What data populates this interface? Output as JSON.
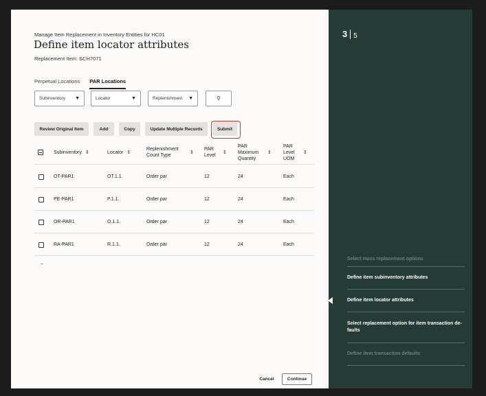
{
  "header": {
    "breadcrumb": "Manage Item Replacement in Inventory Entities for HC01",
    "title": "Define item locator attributes",
    "replacement_item": "Replacement Item: SCH7071"
  },
  "tabs": [
    {
      "label": "Perpetual Locations",
      "active": false
    },
    {
      "label": "PAR Locations",
      "active": true
    }
  ],
  "filters": {
    "subinventory": "Subinventory",
    "locator": "Locator",
    "replenishment": "Replenishment"
  },
  "toolbar": {
    "review": "Review Original Item",
    "add": "Add",
    "copy": "Copy",
    "update_multiple": "Update Multiple Records",
    "submit": "Submit"
  },
  "table": {
    "columns": {
      "subinventory": "Subinventory",
      "locator": "Locator",
      "count_type": "Replenishment Count Type",
      "par_level": "PAR Level",
      "par_max": "PAR Maximum Quantity",
      "uom": "PAR Level UOM"
    },
    "rows": [
      {
        "subinventory": "OT-PAR1",
        "locator": "OT.1.1.",
        "count_type": "Order par",
        "par_level": "12",
        "par_max": "24",
        "uom": "Each"
      },
      {
        "subinventory": "PE-PAR1",
        "locator": "P.1.1.",
        "count_type": "Order par",
        "par_level": "12",
        "par_max": "24",
        "uom": "Each"
      },
      {
        "subinventory": "OR-PAR1",
        "locator": "O.1.1.",
        "count_type": "Order par",
        "par_level": "12",
        "par_max": "24",
        "uom": "Each"
      },
      {
        "subinventory": "RA-PAR1",
        "locator": "R.1.1.",
        "count_type": "Order par",
        "par_level": "12",
        "par_max": "24",
        "uom": "Each"
      }
    ]
  },
  "footer": {
    "cancel": "Cancel",
    "continue": "Continue"
  },
  "progress": {
    "current": "3",
    "total": "5"
  },
  "steps": [
    {
      "label": "Select mass replacement options",
      "state": "disabled"
    },
    {
      "label": "Define item subinventory attributes",
      "state": "done"
    },
    {
      "label": "Define item locator attributes",
      "state": "current"
    },
    {
      "label": "Select replacement option for item transaction de- faults",
      "state": "done"
    },
    {
      "label": "Define item transaction defaults",
      "state": "disabled"
    }
  ],
  "colors": {
    "panel": "#243b36",
    "accent_border": "#d9322d",
    "page": "#fbfaf8"
  },
  "icons": {
    "search": "search-icon",
    "caret": "caret-down-icon",
    "sort": "sort-icon",
    "current_step": "current-step-arrow-icon"
  }
}
